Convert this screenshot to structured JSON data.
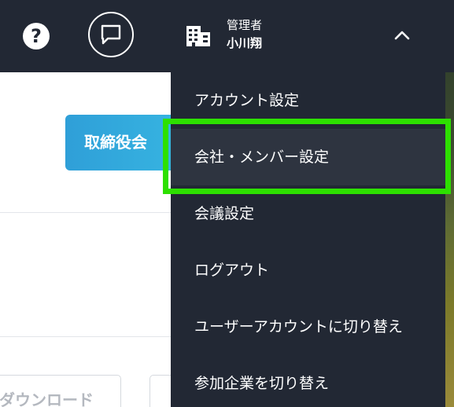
{
  "header": {
    "help_icon_glyph": "?",
    "user": {
      "role": "管理者",
      "name": "小川翔"
    }
  },
  "main": {
    "primary_button_label": "取締役会",
    "download_button_label": "ダウンロード"
  },
  "dropdown": {
    "items": [
      {
        "label": "アカウント設定"
      },
      {
        "label": "会社・メンバー設定"
      },
      {
        "label": "会議設定"
      },
      {
        "label": "ログアウト"
      },
      {
        "label": "ユーザーアカウントに切り替え"
      },
      {
        "label": "参加企業を切り替え"
      }
    ],
    "active_index": 1
  },
  "colors": {
    "topbar": "#222834",
    "dropdown_bg": "#222834",
    "active_item_bg": "#2e3440",
    "highlight": "#2de000",
    "primary_button": "#2f9fd8"
  }
}
